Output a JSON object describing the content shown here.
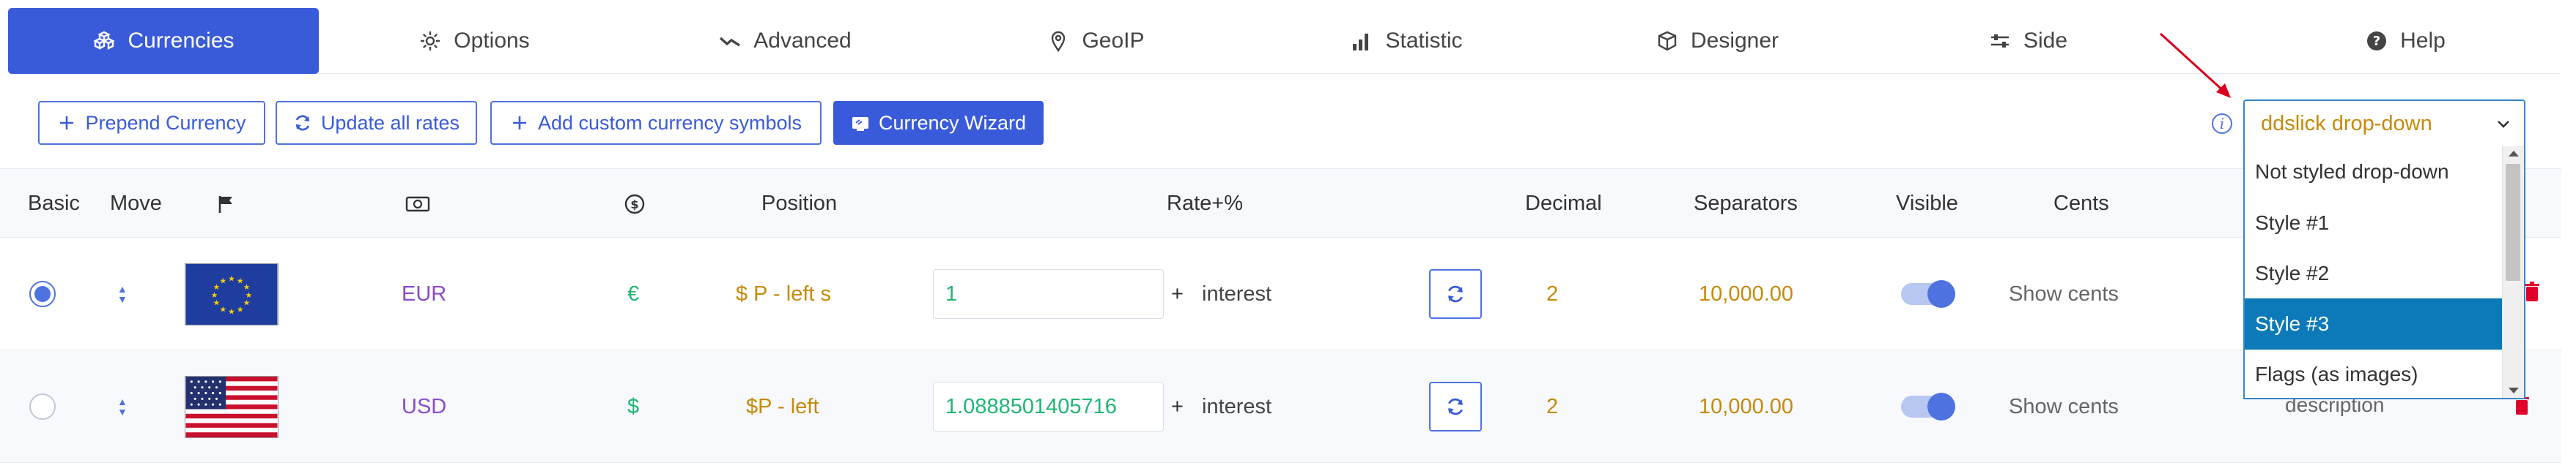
{
  "tabs": [
    {
      "label": "Currencies",
      "icon": "cubes-icon",
      "active": true
    },
    {
      "label": "Options",
      "icon": "gear-icon"
    },
    {
      "label": "Advanced",
      "icon": "trend-icon"
    },
    {
      "label": "GeoIP",
      "icon": "map-pin-icon"
    },
    {
      "label": "Statistic",
      "icon": "bar-chart-icon"
    },
    {
      "label": "Designer",
      "icon": "cube-icon"
    },
    {
      "label": "Side",
      "icon": "sliders-icon"
    },
    {
      "label": "Help",
      "icon": "question-icon"
    }
  ],
  "toolbar": {
    "prepend_label": "Prepend Currency",
    "update_label": "Update all rates",
    "custom_symbols_label": "Add custom currency symbols",
    "wizard_label": "Currency Wizard"
  },
  "table": {
    "headers": {
      "basic": "Basic",
      "move": "Move",
      "position": "Position",
      "rate": "Rate+%",
      "decimal": "Decimal",
      "separators": "Separators",
      "visible": "Visible",
      "cents": "Cents"
    },
    "rows": [
      {
        "basic": true,
        "code": "EUR",
        "symbol": "€",
        "position": "$ P - left s",
        "rate": "1",
        "plus": "+",
        "interest": "interest",
        "decimal": "2",
        "separators": "10,000.00",
        "visible": true,
        "cents": "Show cents"
      },
      {
        "basic": false,
        "code": "USD",
        "symbol": "$",
        "position": "$P - left",
        "rate": "1.0888501405716",
        "plus": "+",
        "interest": "interest",
        "decimal": "2",
        "separators": "10,000.00",
        "visible": true,
        "cents": "Show cents",
        "description": "description"
      }
    ]
  },
  "dropdown": {
    "value": "ddslick drop-down",
    "options": [
      "Not styled drop-down",
      "Style #1",
      "Style #2",
      "Style #3",
      "Flags (as images)"
    ],
    "highlighted_index": 3
  },
  "colors": {
    "accent": "#3a5bd9",
    "code": "#8a4cc7",
    "symbol": "#22b573",
    "position": "#c58a0a",
    "selected_option": "#0c79b8",
    "annotation_arrow": "#d9001b",
    "delete": "#e0002a"
  }
}
